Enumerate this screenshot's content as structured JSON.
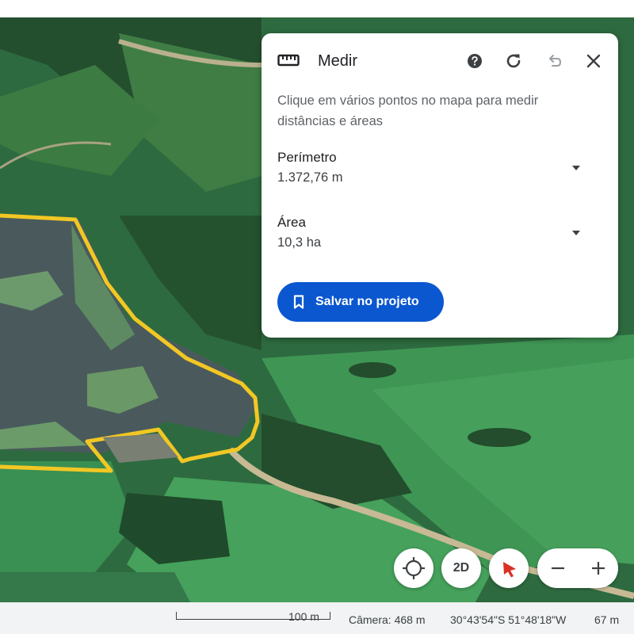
{
  "measure_panel": {
    "title": "Medir",
    "description": "Clique em vários pontos no mapa para medir distâncias e áreas",
    "perimeter": {
      "label": "Perímetro",
      "value": "1.372,76 m"
    },
    "area": {
      "label": "Área",
      "value": "10,3 ha"
    },
    "save_button": "Salvar no projeto",
    "icons": {
      "title": "ruler-icon",
      "help": "help-icon",
      "refresh": "refresh-icon",
      "undo": "undo-icon",
      "close": "close-icon",
      "save": "bookmark-icon"
    }
  },
  "map_controls": {
    "view_mode": "2D",
    "icons": [
      "locate-icon",
      "pegman-icon",
      "zoom-out-icon",
      "zoom-in-icon"
    ]
  },
  "status_bar": {
    "scale": "100 m",
    "camera": "Câmera: 468 m",
    "coordinates": "30°43'54\"S 51°48'18\"W",
    "elevation": "67 m"
  },
  "colors": {
    "accent": "#0b57d0",
    "polygon": "#f2c724",
    "panel_bg": "#ffffff",
    "status_bg": "#f1f3f4"
  }
}
